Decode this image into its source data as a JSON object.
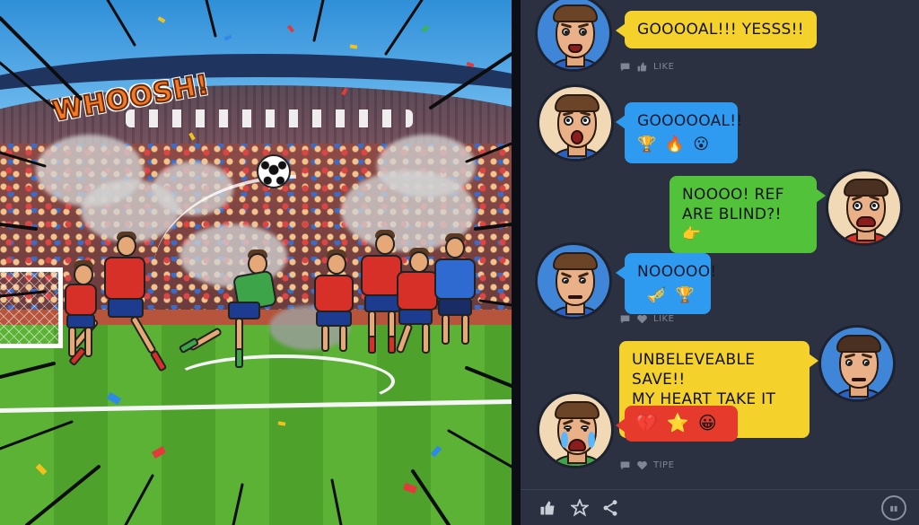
{
  "scene": {
    "sound_effect": "WHOOSH!"
  },
  "chat": {
    "messages": [
      {
        "side": "left",
        "text": "GOOOOAL!!! YESSS!!",
        "emojis": [],
        "color": "#f5d12b"
      },
      {
        "side": "left",
        "text": "GOOOOOAL!!",
        "emojis": [
          "🏆",
          "🔥",
          "😮"
        ],
        "color": "#2e9bf0"
      },
      {
        "side": "right",
        "text_lines": [
          "NOOOO! REF",
          "ARE BLIND?!"
        ],
        "emojis": [
          "👉"
        ],
        "color": "#53c23b"
      },
      {
        "side": "left",
        "text": "NOOOOO!",
        "emojis": [
          "🎺",
          "🏆"
        ],
        "color": "#2e9bf0"
      },
      {
        "side": "right",
        "text_lines": [
          "UNBELEVEABLE SAVE!!",
          "MY HEART TAKE IT"
        ],
        "emojis": [
          "❤️"
        ],
        "color": "#f5d12b"
      },
      {
        "side": "left",
        "text": "",
        "emojis": [
          "💔",
          "⭐",
          "😀"
        ],
        "color": "#e53a2c"
      }
    ],
    "reaction_rows": [
      {
        "label": "LIKE",
        "icons": [
          "comment-icon",
          "thumbs-up-icon"
        ]
      },
      {
        "label": "LIKE",
        "icons": [
          "comment-icon",
          "heart-icon"
        ]
      },
      {
        "label": "TIPE",
        "icons": [
          "comment-icon",
          "heart-icon"
        ]
      }
    ],
    "bottom_bar": {
      "icons": [
        "thumbs-up-icon",
        "star-icon",
        "share-icon",
        "settings-badge-icon"
      ]
    }
  }
}
